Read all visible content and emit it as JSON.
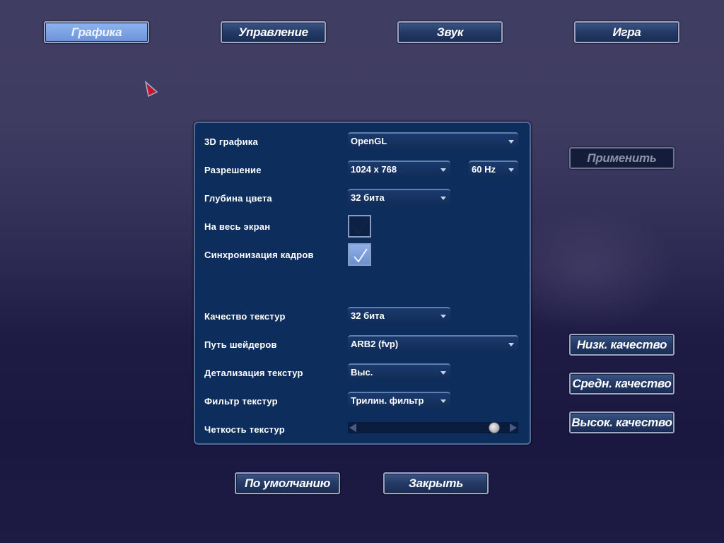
{
  "tabs": [
    {
      "label": "Графика",
      "active": true
    },
    {
      "label": "Управление"
    },
    {
      "label": "Звук"
    },
    {
      "label": "Игра"
    }
  ],
  "settings": {
    "api": {
      "label": "3D графика",
      "value": "OpenGL"
    },
    "resolution": {
      "label": "Разрешение",
      "value": "1024 x 768",
      "refresh": "60 Hz"
    },
    "color_depth": {
      "label": "Глубина цвета",
      "value": "32 бита"
    },
    "fullscreen": {
      "label": "На весь экран",
      "checked": true
    },
    "vsync": {
      "label": "Синхронизация кадров",
      "checked": true
    },
    "texture_quality": {
      "label": "Качество текстур",
      "value": "32 бита"
    },
    "shader_path": {
      "label": "Путь шейдеров",
      "value": "ARB2 (fvp)"
    },
    "texture_detail": {
      "label": "Детализация текстур",
      "value": "Выс."
    },
    "texture_filter": {
      "label": "Фильтр текстур",
      "value": "Трилин. фильтр"
    },
    "texture_sharpness": {
      "label": "Четкость текстур",
      "value_fraction": 0.95
    }
  },
  "apply_label": "Применить",
  "presets": [
    "Низк. качество",
    "Средн. качество",
    "Высок. качество"
  ],
  "bottom": {
    "defaults_label": "По умолчанию",
    "close_label": "Закрыть"
  },
  "colors": {
    "panel": "#0d2d5c",
    "active_tab": "#8fb3ee"
  }
}
